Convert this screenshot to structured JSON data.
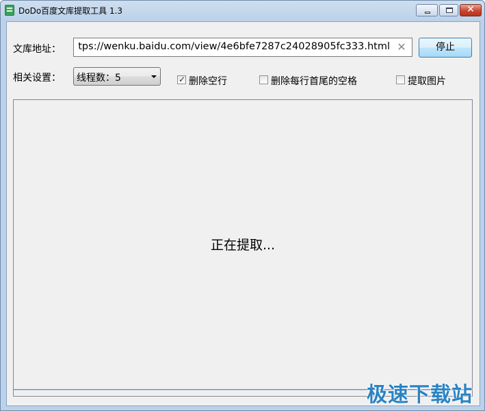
{
  "window": {
    "title": "DoDo百度文库提取工具  1.3",
    "icons": {
      "app": "app-icon",
      "minimize": "minimize-icon",
      "maximize": "maximize-icon",
      "close": "close-icon"
    },
    "close_glyph": "✕"
  },
  "url_row": {
    "label": "文库地址：",
    "url_value": "tps://wenku.baidu.com/view/4e6bfe7287c24028905fc333.html",
    "clear_glyph": "✕",
    "stop_label": "停止"
  },
  "settings_row": {
    "label": "相关设置：",
    "thread_select_value": "线程数：5",
    "checkboxes": [
      {
        "label": "删除空行",
        "checked": true
      },
      {
        "label": "删除每行首尾的空格",
        "checked": false
      },
      {
        "label": "提取图片",
        "checked": false
      }
    ]
  },
  "log": {
    "status": "正在提取..."
  },
  "watermark": "极速下载站",
  "colors": {
    "stop_button_border": "#3c7fb1",
    "close_button": "#c7472e",
    "watermark": "#2b83c4"
  }
}
